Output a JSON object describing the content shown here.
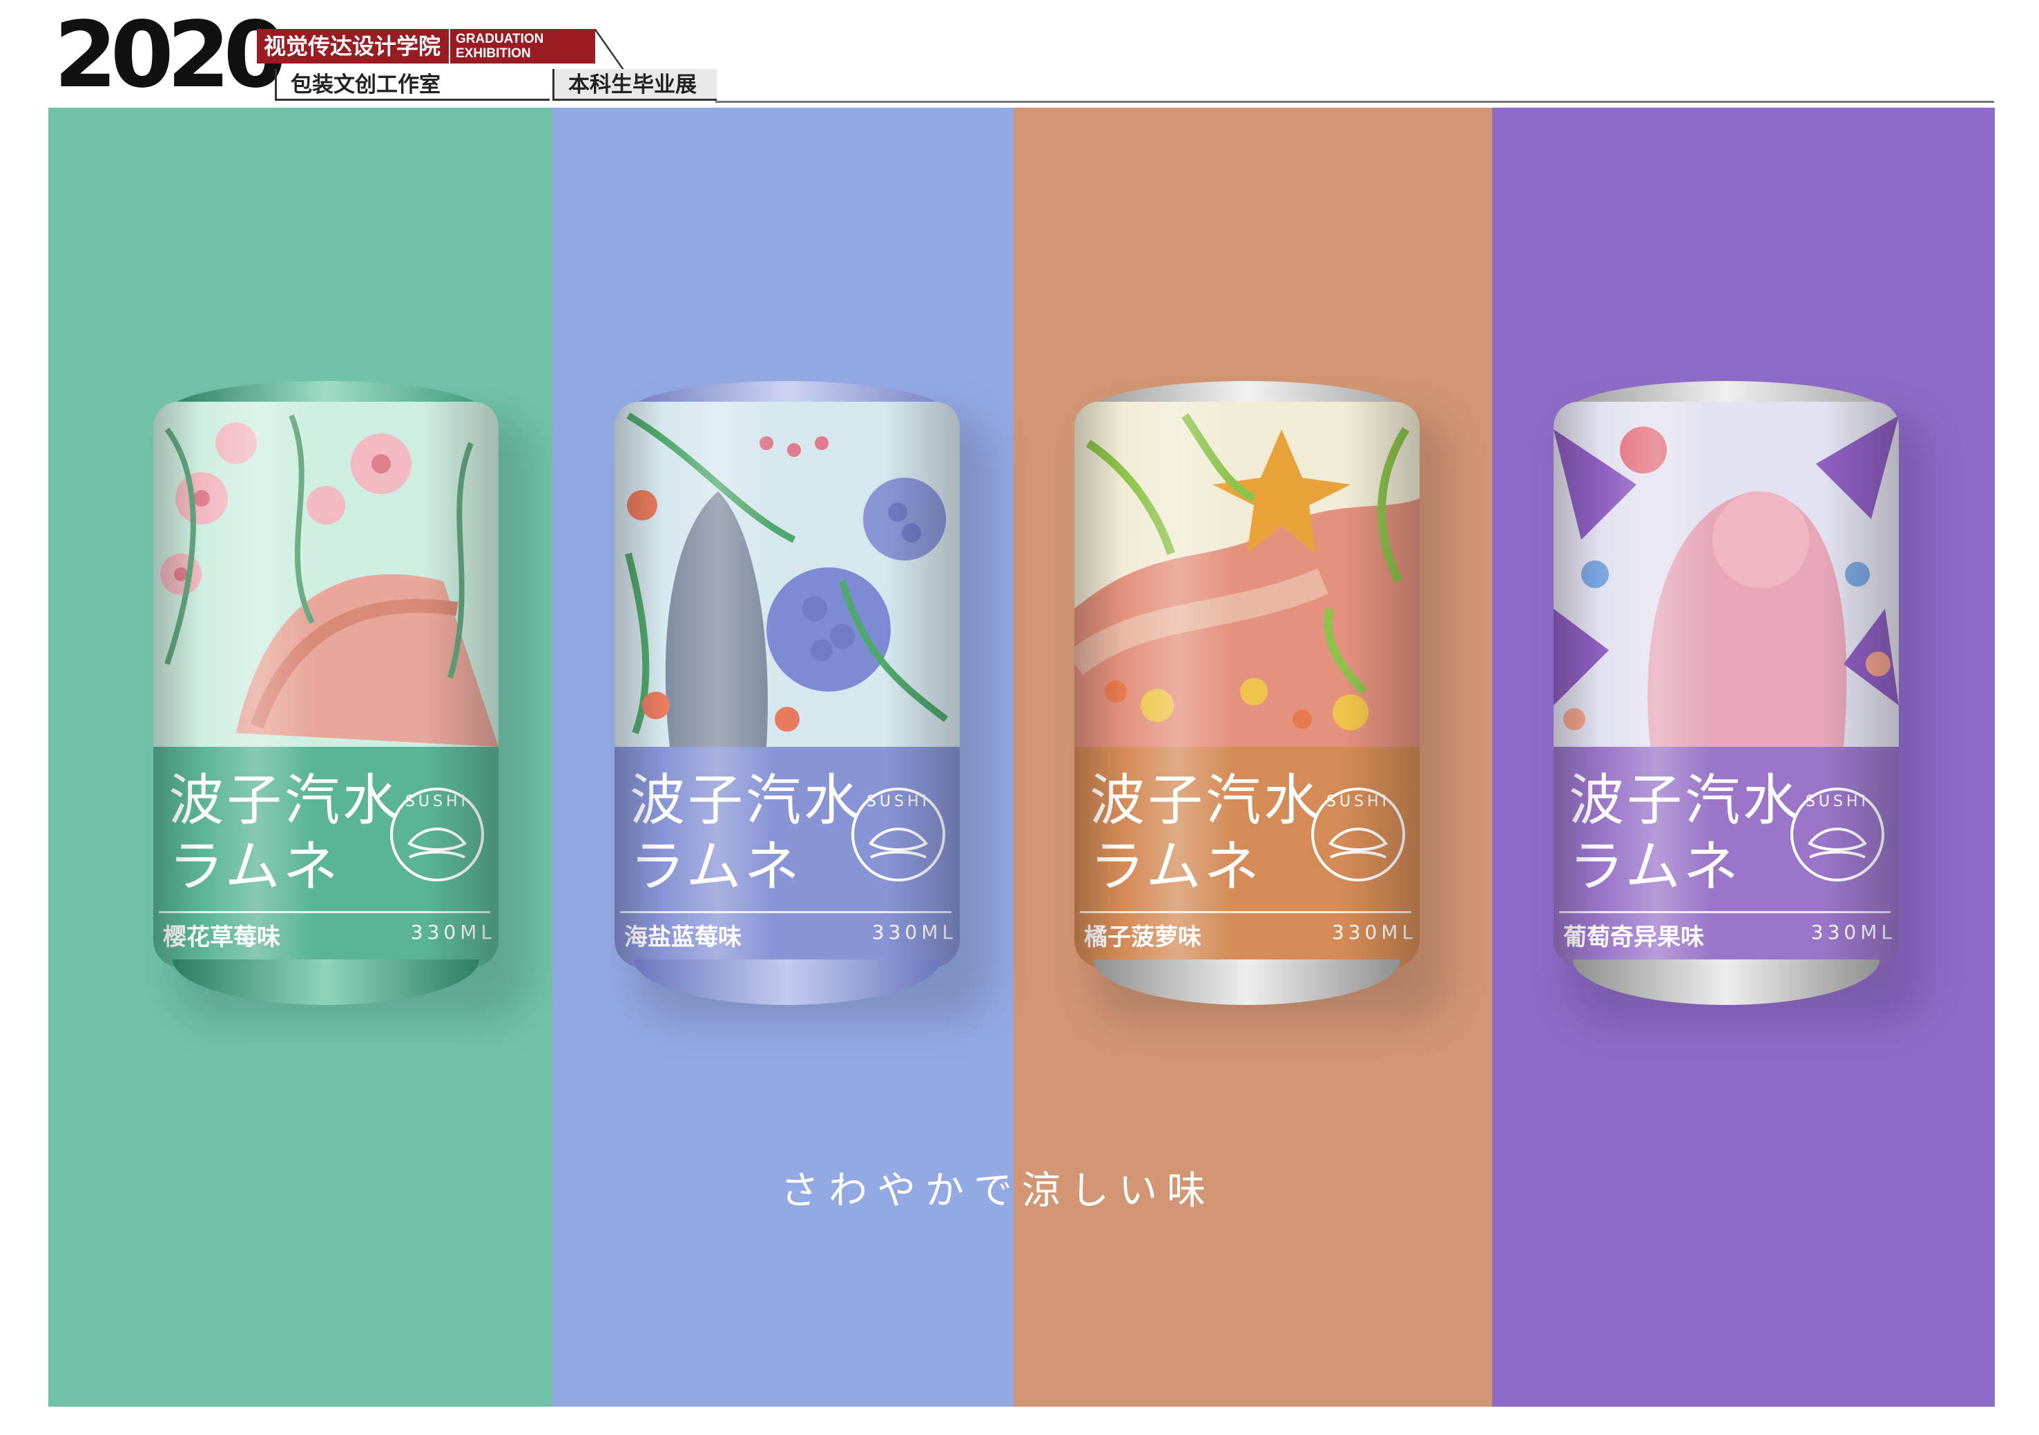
{
  "header": {
    "year": "2020",
    "school": "视觉传达设计学院",
    "exhibition_line1": "GRADUATION",
    "exhibition_line2": "EXHIBITION",
    "studio": "包装文创工作室",
    "show": "本科生毕业展"
  },
  "colors": {
    "green": "#70c3a9",
    "blue": "#93a9e4",
    "orange": "#d29674",
    "purple": "#8e6bc9"
  },
  "cans": [
    {
      "title_line1": "波子汽水",
      "title_line2": "ラムネ",
      "flavor": "樱花草莓味",
      "volume": "330ML",
      "logo_text": "SUSHI",
      "color": "#5ab596"
    },
    {
      "title_line1": "波子汽水",
      "title_line2": "ラムネ",
      "flavor": "海盐蓝莓味",
      "volume": "330ML",
      "logo_text": "SUSHI",
      "color": "#8894d6"
    },
    {
      "title_line1": "波子汽水",
      "title_line2": "ラムネ",
      "flavor": "橘子菠萝味",
      "volume": "330ML",
      "logo_text": "SUSHI",
      "color": "#d48b56"
    },
    {
      "title_line1": "波子汽水",
      "title_line2": "ラムネ",
      "flavor": "葡萄奇异果味",
      "volume": "330ML",
      "logo_text": "SUSHI",
      "color": "#9a75c9"
    }
  ],
  "tagline": "さわやかで涼しい味"
}
